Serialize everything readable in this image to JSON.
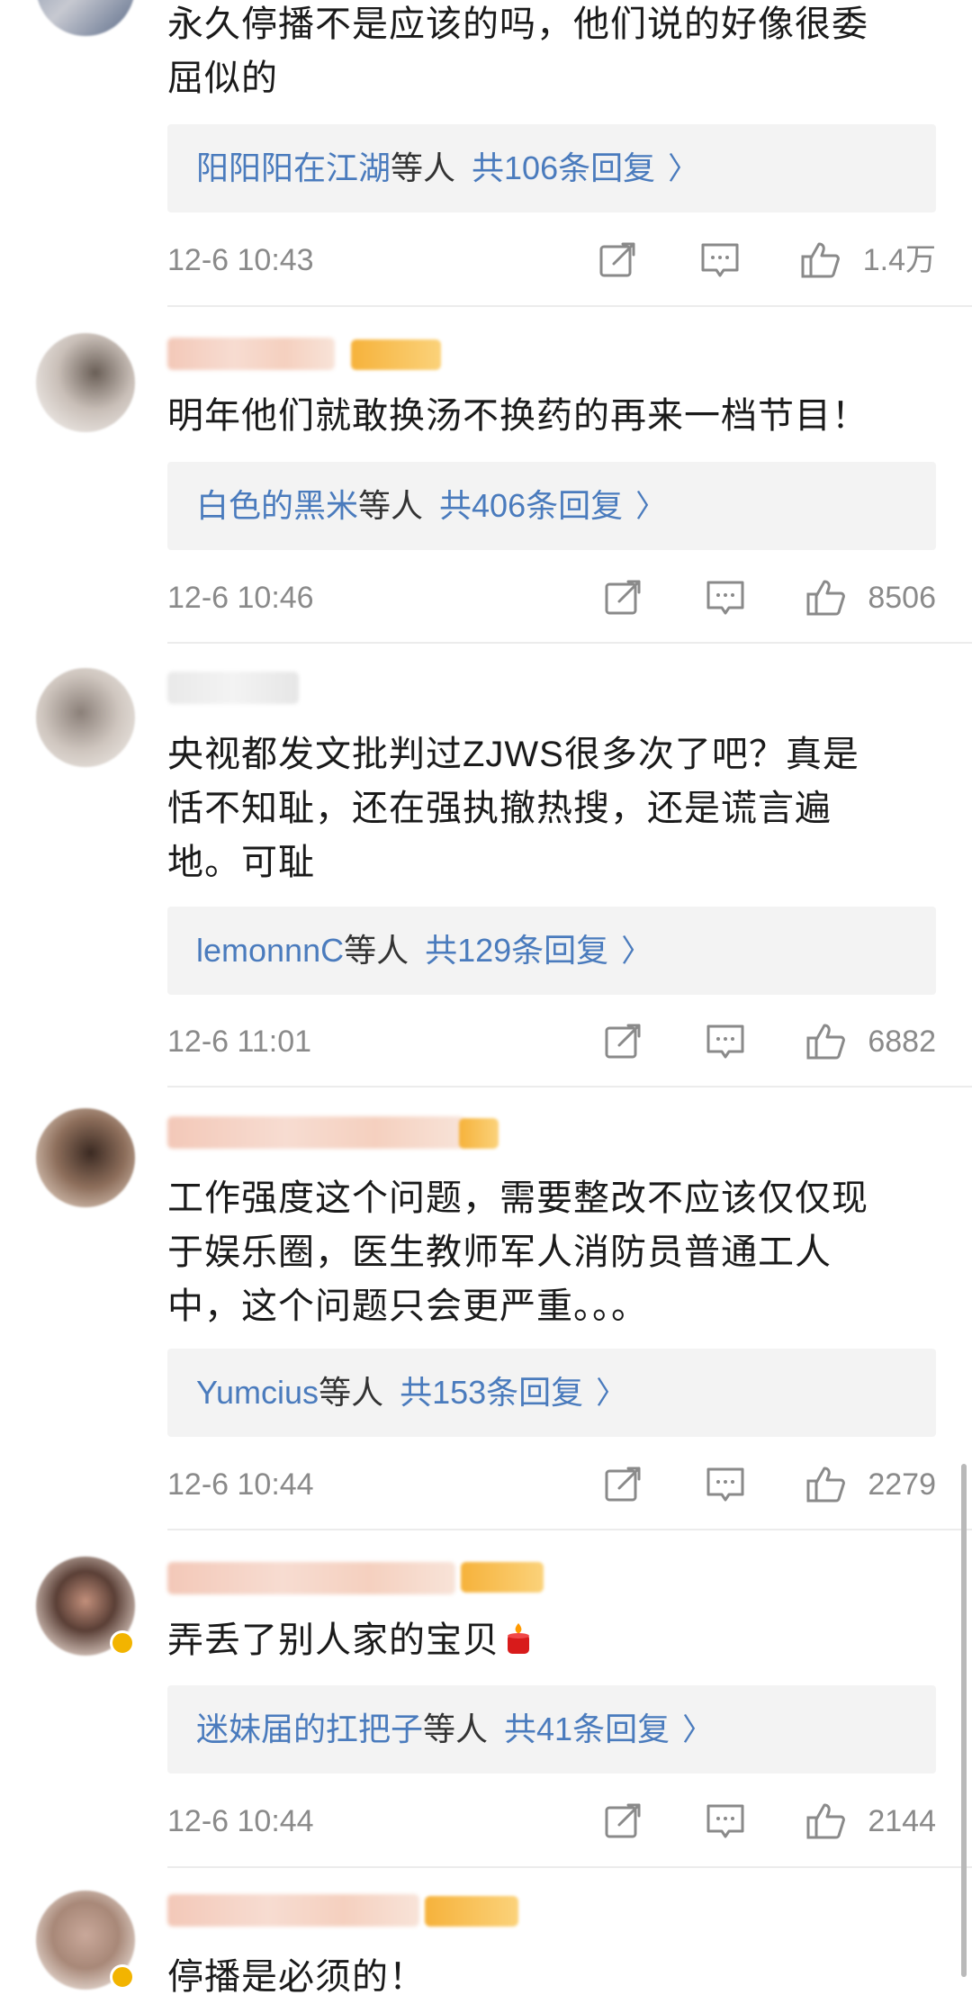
{
  "comments": [
    {
      "text_lines": [
        "永久停播不是应该的吗，他们说的好像很委",
        "屈似的"
      ],
      "reply_names": "阳阳阳在江湖",
      "reply_suffix": "等人",
      "reply_count": "共106条回复",
      "time": "12-6 10:43",
      "likes": "1.4万"
    },
    {
      "text_lines": [
        "明年他们就敢换汤不换药的再来一档节目！"
      ],
      "reply_names": "白色的黑米",
      "reply_suffix": "等人",
      "reply_count": "共406条回复",
      "time": "12-6 10:46",
      "likes": "8506"
    },
    {
      "text_lines": [
        "央视都发文批判过ZJWS很多次了吧？真是",
        "恬不知耻，还在强执撤热搜，还是谎言遍",
        "地。可耻"
      ],
      "reply_names": "lemonnnC",
      "reply_suffix": "等人",
      "reply_count": "共129条回复",
      "time": "12-6 11:01",
      "likes": "6882"
    },
    {
      "text_lines": [
        "工作强度这个问题，需要整改不应该仅仅现",
        "于娱乐圈，医生教师军人消防员普通工人",
        "中，这个问题只会更严重。。。"
      ],
      "reply_names": "Yumcius",
      "reply_suffix": "等人",
      "reply_count": "共153条回复",
      "time": "12-6 10:44",
      "likes": "2279"
    },
    {
      "text_lines": [
        "弄丢了别人家的宝贝"
      ],
      "reply_names": "迷妹届的扛把子",
      "reply_suffix": "等人",
      "reply_count": "共41条回复",
      "time": "12-6 10:44",
      "likes": "2144"
    },
    {
      "text_lines": [
        "停播是必须的！"
      ]
    }
  ],
  "icons": {
    "share": "share-icon",
    "comment": "comment-icon",
    "like": "thumbs-up-icon",
    "chevron": "chevron-right-icon",
    "candle": "candle-emoji-icon"
  },
  "chevron_glyph": "〉",
  "colors": {
    "link": "#4a7bbd",
    "meta": "#8a8a8a",
    "reply_bg": "#f3f3f3"
  }
}
